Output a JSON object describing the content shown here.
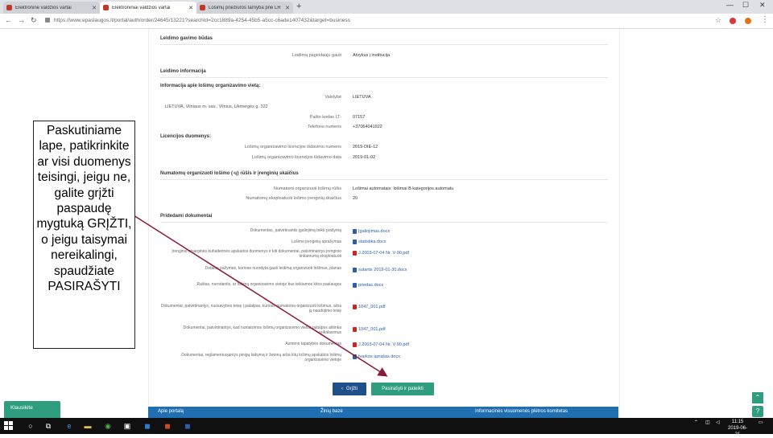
{
  "browser": {
    "tabs": [
      {
        "title": "Elektroninė valdžios vartai",
        "active": false
      },
      {
        "title": "Elektroniniai valdžios vartai",
        "active": true
      },
      {
        "title": "Lošimų priežiūros tarnyba prie LR",
        "active": false
      }
    ],
    "url": "https://www.epaslaugos.lt/portal/auth/order/24645/13221?searchId=2cc1889a-4254-45b5-a5cc-c6ade1407432&target=business"
  },
  "sections": {
    "issue_method": {
      "title": "Leidimo gavimo būdas",
      "label": "Leidimą pageidauju gauti",
      "value": "Atvykus į institucija"
    },
    "permit_info": {
      "title": "Leidimo informacija"
    },
    "location": {
      "title": "Informacija apie lošimų organizavimo vietą:",
      "country_label": "Valstybė",
      "country_value": "LIETUVA",
      "address": "LIETUVA, Vilniaus m. sav., Vilnius, Ukmergės g. 322",
      "postal_label": "Pašto kodas LT-",
      "postal_value": "07157",
      "phone_label": "Telefono numeris",
      "phone_value": "+37064041922"
    },
    "license": {
      "title": "Licencijos duomenys:",
      "number_label": "Lošimų organizavimo licencijos išdavimo numeris",
      "number_value": "2019-DIE-12",
      "date_label": "Lošimų organizavimo licencijos išdavimo data",
      "date_value": "2019-01-02"
    },
    "devices": {
      "title": "Numatomų organizuoti lošimo (-ų) rūšis ir įrenginių skaičius",
      "type_label": "Numatomi organizuoti lošimų rūšis",
      "type_value": "Lošimai automatais: lošimai B kategorijos automatu",
      "count_label": "Numatomų eksploatuoti lošimo įrenginių skaičius",
      "count_value": "20"
    },
    "attachments": {
      "title": "Pridedami dokumentai",
      "items": [
        {
          "label": "Dokumentas, patvirtinantis įgaliojimą teikti prašymą",
          "file": "Įgaliojimas.docx",
          "kind": "word"
        },
        {
          "label": "Lošimo įrenginių aprašymas",
          "file": "statistika.docx",
          "kind": "word"
        },
        {
          "label": "Įrenginio atsarginės buhalterinės apskaitos duomenys ir kiti dokumentai, patvirtinantys įrenginio tinkamumą eksploatuoti",
          "file": "J.2003-07-04 Nr. V-90.pdf",
          "kind": "pdf"
        },
        {
          "label": "Detalus pažymas, kuriose nurodyta gauti leidimą organizuoti lošimus, planas",
          "file": "sutartis 2019-01-30.docx",
          "kind": "word"
        },
        {
          "label": "Raštas, nurodantis, ar lošimų organizavimo vietoje bus teikiamos kitos paslaugos",
          "file": "priedas.docx",
          "kind": "word"
        },
        {
          "label": "Dokumentai, patvirtinantys, nuosavybės teisę į patalpas, kuriose numatoma organizuoti lošimus, arba jų naudojimo teisę",
          "file": "1047_001.pdf",
          "kind": "pdf"
        },
        {
          "label": "Dokumentai, patvirtinantys, kad numatomos lošimų organizavimo vietos patalpos atitinka reikalavimus",
          "file": "1047_001.pdf",
          "kind": "pdf"
        },
        {
          "label": "Asmens tapatybės dokumentas",
          "file": "J.2003-07-04 Nr. V-90.pdf",
          "kind": "pdf"
        },
        {
          "label": "Dokumentai, reglamentuojantys pinigų laikymą ir žetonų arba kitų lošimų apskaitos lošimų organizavimo vietoje",
          "file": "tvarkos aprašas.docx",
          "kind": "word"
        }
      ]
    }
  },
  "actions": {
    "back_label": "Grįžti",
    "sign_label": "Pasirašyti ir pateikti"
  },
  "footer": {
    "left": "Apie portalą",
    "middle": "Žinių bazė",
    "right": "Informacinės visuomenės plėtros komitetas"
  },
  "side_tab": "Klausikite",
  "callout_text": "Paskutiniame lape, patikrinkite ar visi duomenys teisingi, jeigu ne, galite grįžti paspaudę mygtuką GRĮŽTI, o jeigu taisymai nereikalingi, spaudžiate PASIRAŠYTI",
  "taskbar": {
    "time": "11:15",
    "date": "2019-06-21"
  },
  "colors": {
    "primary_blue": "#1f4f8b",
    "action_green": "#2e9e7e",
    "footer_blue": "#1f6fb2",
    "arrow": "#8b1a3a"
  }
}
